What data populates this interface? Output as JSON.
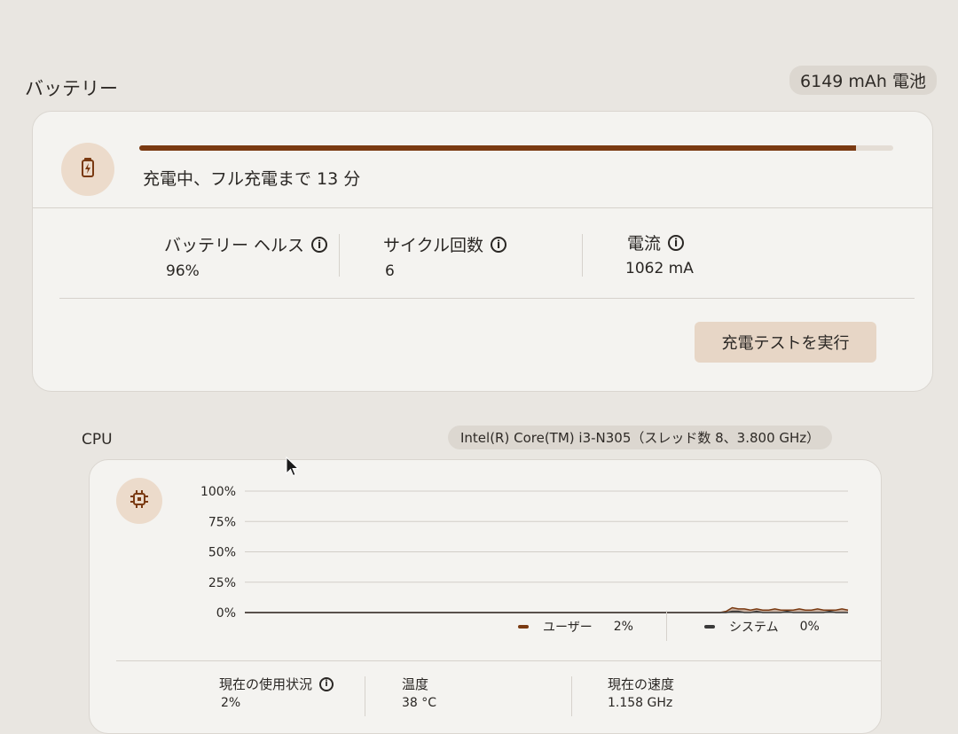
{
  "battery": {
    "section_title": "バッテリー",
    "capacity_chip": "6149 mAh 電池",
    "icon": "battery-charging-icon",
    "charge_level": 0.95,
    "status_text": "充電中、フル充電まで 13 分",
    "health_label": "バッテリー ヘルス",
    "health_value": "96%",
    "cycle_label": "サイクル回数",
    "cycle_value": "6",
    "current_label": "電流",
    "current_value": "1062 mA",
    "charge_test_button": "充電テストを実行",
    "accent_color": "#7a3a12"
  },
  "cpu": {
    "section_title": "CPU",
    "model_chip": "Intel(R) Core(TM) i3-N305（スレッド数 8、3.800 GHz）",
    "icon": "cpu-chip-icon",
    "usage_label": "現在の使用状況",
    "usage_value": "2%",
    "temp_label": "温度",
    "temp_value": "38 °C",
    "speed_label": "現在の速度",
    "speed_value": "1.158 GHz",
    "legend": {
      "user_label": "ユーザー",
      "user_value": "2%",
      "system_label": "システム",
      "system_value": "0%"
    }
  },
  "chart_data": {
    "type": "area",
    "y_ticks": [
      "100%",
      "75%",
      "50%",
      "25%",
      "0%"
    ],
    "ylim": [
      0,
      100
    ],
    "grid": true,
    "series": [
      {
        "name": "ユーザー",
        "color": "#7a3a12",
        "values": [
          0,
          0,
          0,
          0,
          0,
          0,
          0,
          0,
          0,
          0,
          0,
          0,
          0,
          0,
          0,
          0,
          0,
          0,
          0,
          0,
          0,
          0,
          0,
          0,
          0,
          0,
          0,
          0,
          0,
          0,
          0,
          0,
          0,
          0,
          0,
          0,
          0,
          0,
          0,
          0,
          0,
          0,
          0,
          0,
          0,
          0,
          0,
          0,
          0,
          0,
          0,
          0,
          0,
          0,
          0,
          0,
          0,
          0,
          0,
          0,
          0,
          0,
          0,
          0,
          0,
          0,
          0,
          0,
          0,
          0,
          0,
          0,
          0,
          0,
          0,
          0,
          0,
          0,
          0,
          1,
          4,
          3,
          3,
          2,
          3,
          2,
          2,
          3,
          2,
          2,
          2,
          3,
          2,
          2,
          3,
          2,
          2,
          2,
          3,
          2
        ]
      },
      {
        "name": "システム",
        "color": "#3a3a3a",
        "values": [
          0,
          0,
          0,
          0,
          0,
          0,
          0,
          0,
          0,
          0,
          0,
          0,
          0,
          0,
          0,
          0,
          0,
          0,
          0,
          0,
          0,
          0,
          0,
          0,
          0,
          0,
          0,
          0,
          0,
          0,
          0,
          0,
          0,
          0,
          0,
          0,
          0,
          0,
          0,
          0,
          0,
          0,
          0,
          0,
          0,
          0,
          0,
          0,
          0,
          0,
          0,
          0,
          0,
          0,
          0,
          0,
          0,
          0,
          0,
          0,
          0,
          0,
          0,
          0,
          0,
          0,
          0,
          0,
          0,
          0,
          0,
          0,
          0,
          0,
          0,
          0,
          0,
          0,
          0,
          0,
          1,
          1,
          0,
          0,
          1,
          0,
          0,
          0,
          0,
          1,
          0,
          0,
          0,
          0,
          0,
          0,
          1,
          0,
          0,
          0
        ]
      }
    ]
  }
}
